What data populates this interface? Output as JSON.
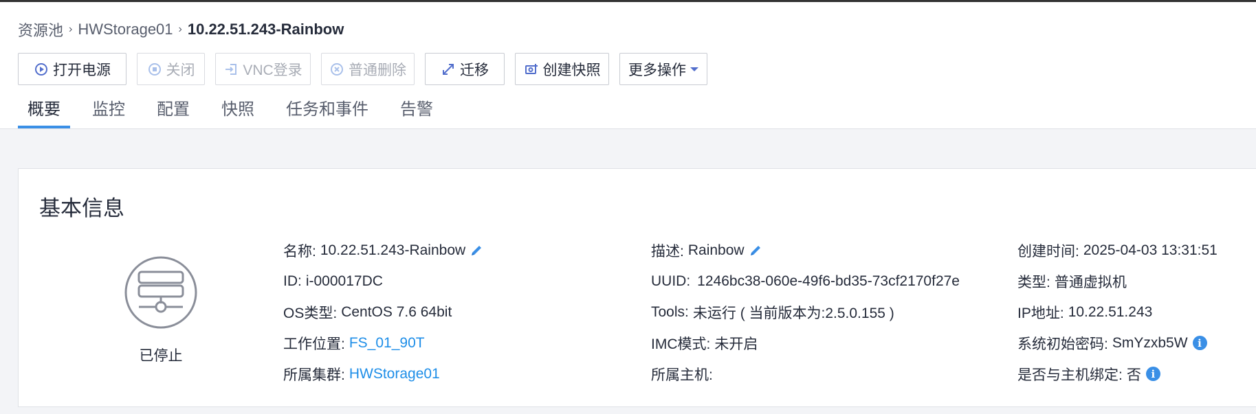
{
  "breadcrumb": {
    "items": [
      "资源池",
      "HWStorage01"
    ],
    "current": "10.22.51.243-Rainbow"
  },
  "toolbar": {
    "buttons": [
      {
        "label": "打开电源",
        "icon": "play-circle-icon",
        "enabled": true
      },
      {
        "label": "关闭",
        "icon": "stop-circle-icon",
        "enabled": false
      },
      {
        "label": "VNC登录",
        "icon": "login-icon",
        "enabled": false
      },
      {
        "label": "普通删除",
        "icon": "delete-circle-icon",
        "enabled": false
      },
      {
        "label": "迁移",
        "icon": "migrate-arrows-icon",
        "enabled": true
      },
      {
        "label": "创建快照",
        "icon": "snapshot-icon",
        "enabled": true
      },
      {
        "label": "更多操作",
        "icon": "caret-down-icon",
        "enabled": true
      }
    ]
  },
  "tabs": [
    {
      "label": "概要",
      "active": true
    },
    {
      "label": "监控",
      "active": false
    },
    {
      "label": "配置",
      "active": false
    },
    {
      "label": "快照",
      "active": false
    },
    {
      "label": "任务和事件",
      "active": false
    },
    {
      "label": "告警",
      "active": false
    }
  ],
  "card": {
    "title": "基本信息",
    "status": "已停止",
    "status_icon": "vm-server-icon",
    "col1": {
      "name_label": "名称:",
      "name_value": "10.22.51.243-Rainbow",
      "id_label": "ID:",
      "id_value": "i-000017DC",
      "os_label": "OS类型:",
      "os_value": "CentOS 7.6 64bit",
      "location_label": "工作位置:",
      "location_value": "FS_01_90T",
      "cluster_label": "所属集群:",
      "cluster_value": "HWStorage01"
    },
    "col2": {
      "desc_label": "描述:",
      "desc_value": "Rainbow",
      "uuid_label": "UUID:",
      "uuid_value": "1246bc38-060e-49f6-bd35-73cf2170f27e",
      "tools_label": "Tools:",
      "tools_value": "未运行 ( 当前版本为:2.5.0.155 )",
      "imc_label": "IMC模式:",
      "imc_value": "未开启",
      "host_label": "所属主机:",
      "host_value": ""
    },
    "col3": {
      "created_label": "创建时间:",
      "created_value": "2025-04-03 13:31:51",
      "type_label": "类型:",
      "type_value": "普通虚拟机",
      "ip_label": "IP地址:",
      "ip_value": "10.22.51.243",
      "pwd_label": "系统初始密码:",
      "pwd_value": "SmYzxb5W",
      "bind_label": "是否与主机绑定:",
      "bind_value": "否"
    }
  },
  "colors": {
    "accent": "#3a8fe6",
    "link": "#1e8ee8",
    "disabled_text": "#a9adb6",
    "background": "#f3f4f7"
  }
}
